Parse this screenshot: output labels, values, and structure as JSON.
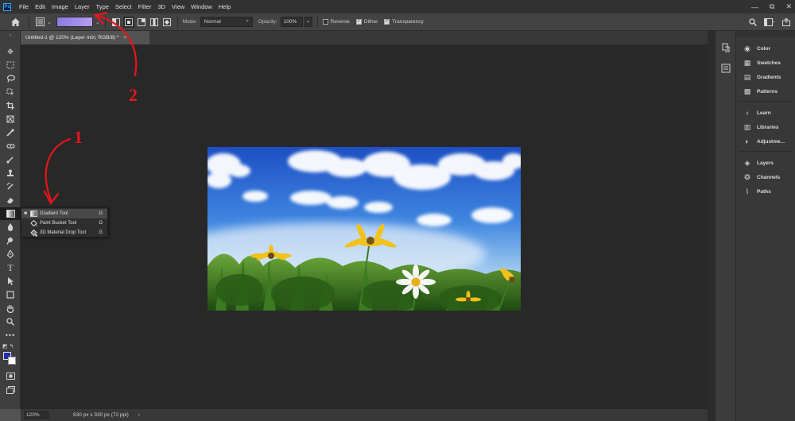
{
  "app": {
    "logo": "Ps"
  },
  "menu": [
    "File",
    "Edit",
    "Image",
    "Layer",
    "Type",
    "Select",
    "Filter",
    "3D",
    "View",
    "Window",
    "Help"
  ],
  "window_controls": {
    "minimize": "—",
    "restore": "⧉",
    "close": "✕"
  },
  "options": {
    "mode_label": "Mode:",
    "mode_value": "Normal",
    "opacity_label": "Opacity:",
    "opacity_value": "100%",
    "reverse_label": "Reverse",
    "reverse_checked": false,
    "dither_label": "Dither",
    "dither_checked": true,
    "transparency_label": "Transparency",
    "transparency_checked": true,
    "gradient_colors": [
      "#8a7be0",
      "#b79cf2"
    ]
  },
  "document": {
    "tab_title": "Untitled-1 @ 120% (Layer mới, RGB/8) *",
    "close": "×"
  },
  "status": {
    "zoom": "120%",
    "info": "630 px x 330 px (72 ppi)",
    "arrow": "›"
  },
  "flyout": {
    "items": [
      {
        "label": "Gradient Tool",
        "key": "G"
      },
      {
        "label": "Paint Bucket Tool",
        "key": "G"
      },
      {
        "label": "3D Material Drop Tool",
        "key": "G"
      }
    ]
  },
  "panels": [
    {
      "label": "Color",
      "icon": "color-wheel-icon"
    },
    {
      "label": "Swatches",
      "icon": "swatches-icon"
    },
    {
      "label": "Gradients",
      "icon": "gradients-icon"
    },
    {
      "label": "Patterns",
      "icon": "patterns-icon"
    },
    {
      "label": "Learn",
      "icon": "lightbulb-icon"
    },
    {
      "label": "Libraries",
      "icon": "libraries-icon"
    },
    {
      "label": "Adjustme...",
      "icon": "adjustments-icon"
    },
    {
      "label": "Layers",
      "icon": "layers-icon"
    },
    {
      "label": "Channels",
      "icon": "channels-icon"
    },
    {
      "label": "Paths",
      "icon": "paths-icon"
    }
  ],
  "annotations": {
    "one": "1",
    "two": "2",
    "color": "#e8141c"
  },
  "colors": {
    "foreground": "#2330a8",
    "background": "#ffffff"
  }
}
